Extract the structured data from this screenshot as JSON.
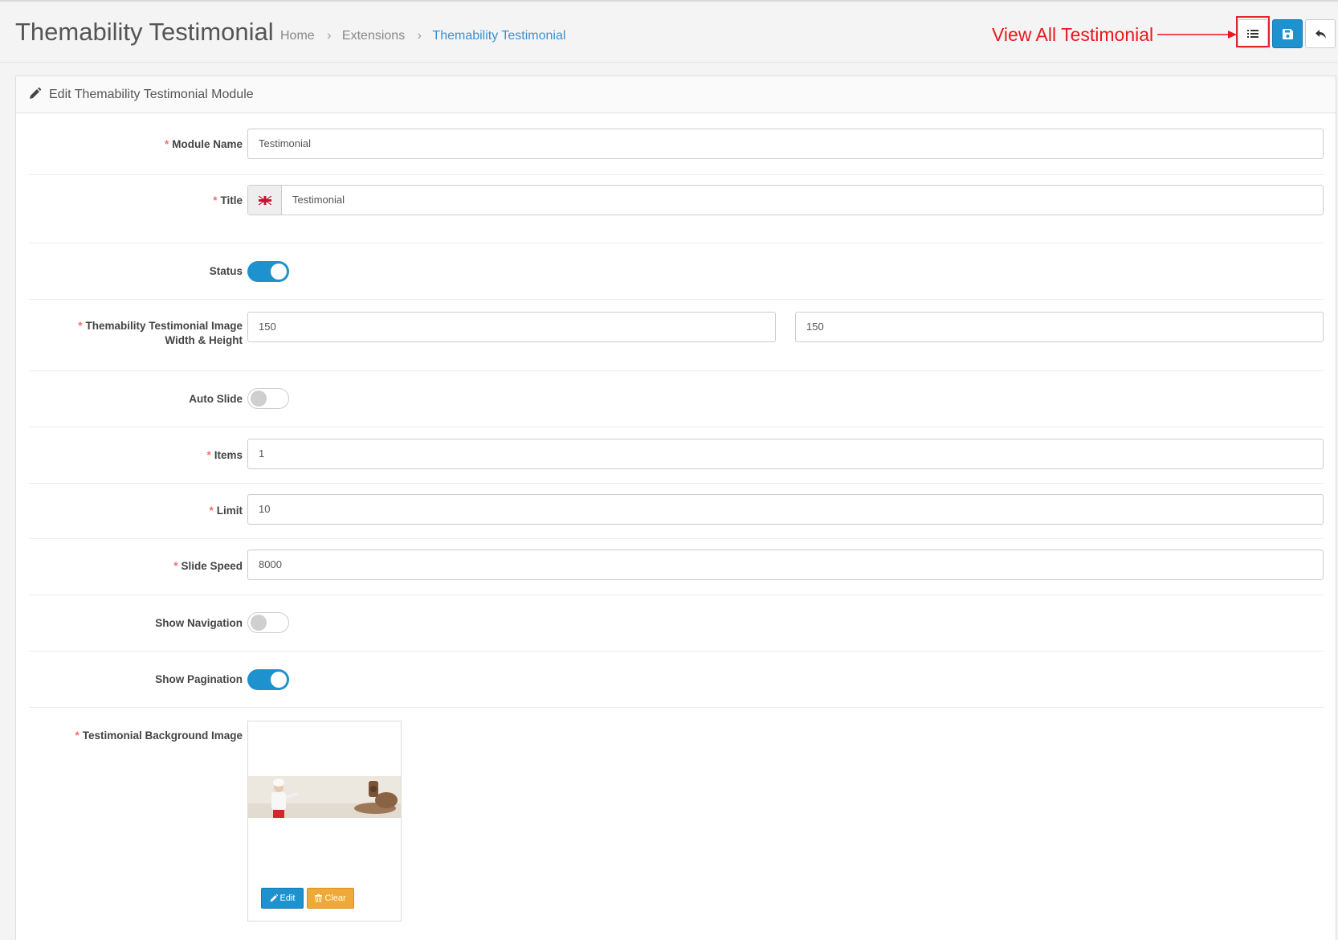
{
  "header": {
    "title": "Themability Testimonial",
    "breadcrumb": [
      "Home",
      "Extensions",
      "Themability Testimonial"
    ],
    "annotation": "View All Testimonial",
    "buttons": {
      "list_icon": "list-icon",
      "save_icon": "save-icon",
      "back_icon": "reply-icon"
    }
  },
  "panel": {
    "icon": "pencil-icon",
    "title": "Edit Themability Testimonial Module"
  },
  "form": {
    "module_name": {
      "label": "Module Name",
      "required": true,
      "value": "Testimonial"
    },
    "title": {
      "label": "Title",
      "required": true,
      "value": "Testimonial",
      "flag_icon": "uk-flag-icon"
    },
    "status": {
      "label": "Status",
      "on": true
    },
    "image_size": {
      "label_line1": "Themability Testimonial Image",
      "label_line2": "Width & Height",
      "required": true,
      "width": "150",
      "height": "150"
    },
    "auto_slide": {
      "label": "Auto Slide",
      "on": false
    },
    "items": {
      "label": "Items",
      "required": true,
      "value": "1"
    },
    "limit": {
      "label": "Limit",
      "required": true,
      "value": "10"
    },
    "slide_speed": {
      "label": "Slide Speed",
      "required": true,
      "value": "8000"
    },
    "show_navigation": {
      "label": "Show Navigation",
      "on": false
    },
    "show_pagination": {
      "label": "Show Pagination",
      "on": true
    },
    "background_image": {
      "label": "Testimonial Background Image",
      "required": true,
      "edit_label": "Edit",
      "clear_label": "Clear"
    }
  },
  "colors": {
    "primary": "#1e91cf",
    "warning": "#f0a838",
    "annotation": "#e8191c",
    "required": "#f56b6b"
  }
}
